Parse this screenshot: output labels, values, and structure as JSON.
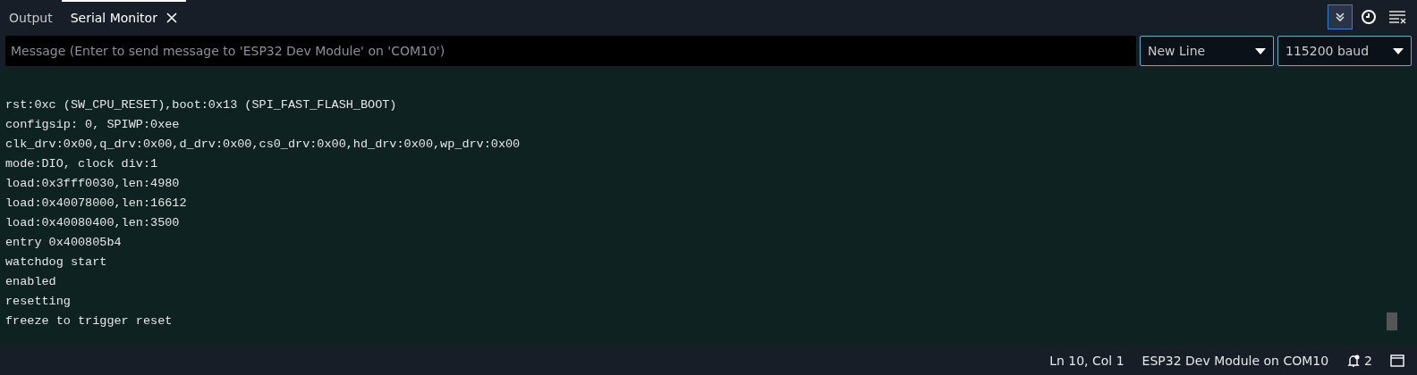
{
  "tabs": [
    {
      "label": "Output",
      "selected": false,
      "closable": false
    },
    {
      "label": "Serial Monitor",
      "selected": true,
      "closable": true
    }
  ],
  "toolbar": {
    "autoscroll": {
      "on": true
    },
    "timestamp": {
      "on": false
    }
  },
  "message": {
    "placeholder": "Message (Enter to send message to 'ESP32 Dev Module' on 'COM10')"
  },
  "line_ending": {
    "value": "New Line"
  },
  "baud_rate": {
    "value": "115200 baud"
  },
  "output_lines": [
    "rst:0xc (SW_CPU_RESET),boot:0x13 (SPI_FAST_FLASH_BOOT)",
    "configsip: 0, SPIWP:0xee",
    "clk_drv:0x00,q_drv:0x00,d_drv:0x00,cs0_drv:0x00,hd_drv:0x00,wp_drv:0x00",
    "mode:DIO, clock div:1",
    "load:0x3fff0030,len:4980",
    "load:0x40078000,len:16612",
    "load:0x40080400,len:3500",
    "entry 0x400805b4",
    "watchdog start",
    "enabled",
    "resetting",
    "freeze to trigger reset"
  ],
  "status_bar": {
    "position": "Ln 10, Col 1",
    "board": "ESP32 Dev Module on COM10",
    "notifications": "2"
  }
}
